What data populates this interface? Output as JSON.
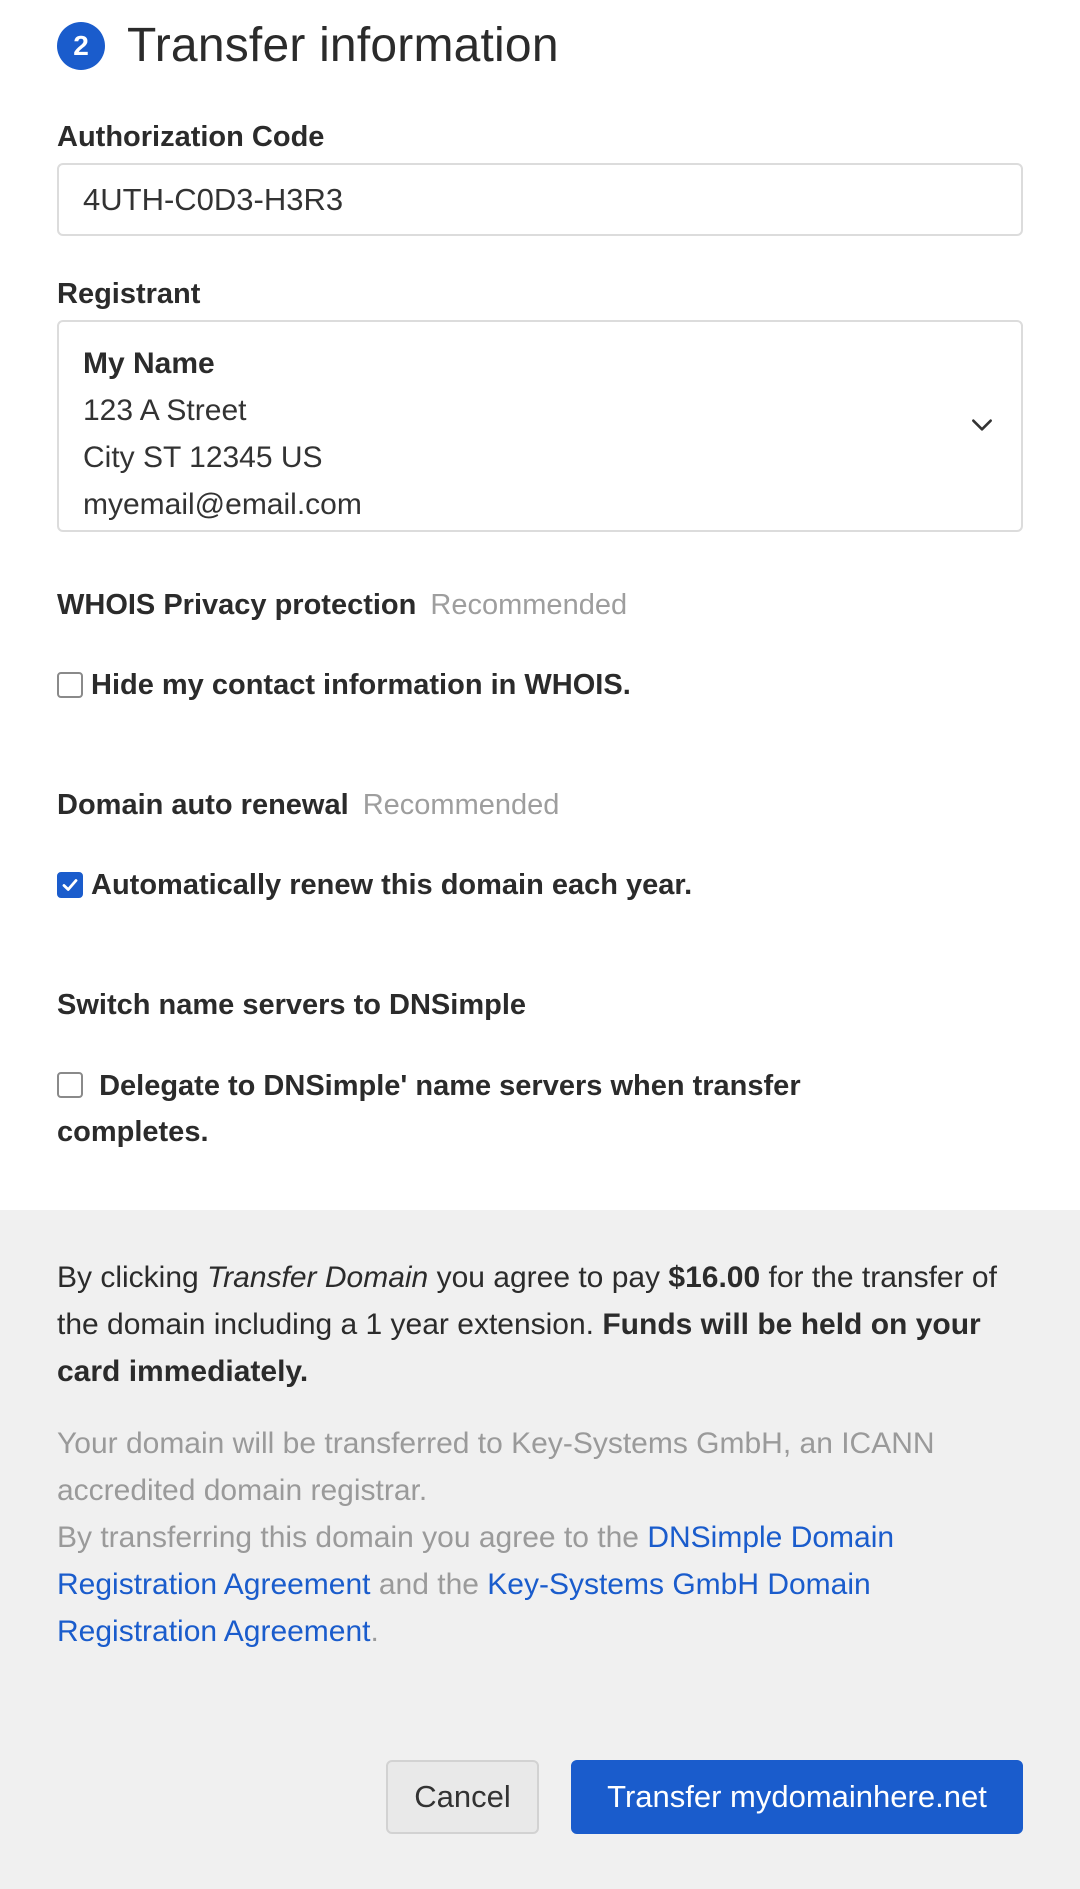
{
  "step": {
    "number": "2",
    "title": "Transfer information"
  },
  "auth_code": {
    "label": "Authorization Code",
    "value": "4UTH-C0D3-H3R3"
  },
  "registrant": {
    "label": "Registrant",
    "name": "My Name",
    "street": "123 A Street",
    "city_line": "City ST 12345 US",
    "email": "myemail@email.com"
  },
  "whois": {
    "heading": "WHOIS Privacy protection",
    "tag": "Recommended",
    "checkbox_label": "Hide my contact information in WHOIS.",
    "checked": false
  },
  "auto_renew": {
    "heading": "Domain auto renewal",
    "tag": "Recommended",
    "checkbox_label": "Automatically renew this domain each year.",
    "checked": true
  },
  "name_servers": {
    "heading": "Switch name servers to DNSimple",
    "checkbox_label": "Delegate to DNSimple' name servers when transfer completes.",
    "checked": false
  },
  "agreement": {
    "part1": "By clicking ",
    "action_name": "Transfer Domain",
    "part2": " you agree to pay ",
    "price": "$16.00",
    "part3": " for the transfer of the domain including a 1 year extension. ",
    "funds_notice": "Funds will be held on your card immediately."
  },
  "legal": {
    "registrar_text": "Your domain will be transferred to Key-Systems GmbH, an ICANN accredited domain registrar.",
    "agree_prefix": "By transferring this domain you agree to the ",
    "link1": "DNSimple Domain Registration Agreement",
    "and_text": " and the ",
    "link2": "Key-Systems GmbH Domain Registration Agreement",
    "end": "."
  },
  "buttons": {
    "cancel": "Cancel",
    "submit": "Transfer mydomainhere.net"
  },
  "colors": {
    "primary": "#1a5ccc",
    "footer_bg": "#f0f0f0",
    "muted_text": "#9e9e9e"
  }
}
